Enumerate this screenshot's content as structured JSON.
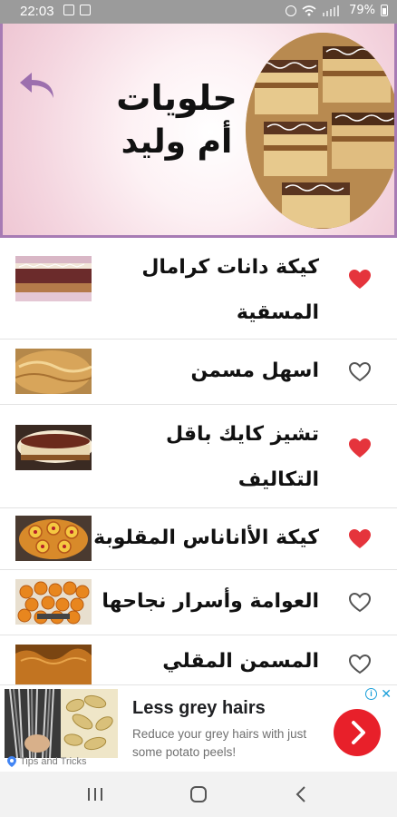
{
  "status_bar": {
    "time": "22:03",
    "battery_text": "79%",
    "icons": [
      "image-icon",
      "nfc-icon",
      "alarm-icon",
      "wifi-icon",
      "signal-icon",
      "battery-icon"
    ]
  },
  "banner": {
    "title_line1": "حلويات",
    "title_line2": "أم وليد",
    "back_icon": "back-arrow-icon",
    "accent_color": "#a77bb4"
  },
  "recipes": [
    {
      "title": "كيكة دانات كرامال المسقية",
      "favorite": true,
      "thumb": "caramel-cake"
    },
    {
      "title": "اسهل مسمن",
      "favorite": false,
      "thumb": "msemen"
    },
    {
      "title": "تشيز كايك باقل التكاليف",
      "favorite": true,
      "thumb": "cheesecake"
    },
    {
      "title": "كيكة الأاناناس المقلوبة",
      "favorite": true,
      "thumb": "pineapple-cake"
    },
    {
      "title": "العوامة وأسرار نجاحها",
      "favorite": false,
      "thumb": "awama"
    },
    {
      "title": "المسمن المقلي التقليدي",
      "favorite": false,
      "thumb": "fried-msemen"
    }
  ],
  "colors": {
    "heart_filled": "#e5343c",
    "heart_outline": "#555555"
  },
  "ad": {
    "title": "Less grey hairs",
    "body": "Reduce your grey hairs with just some potato peels!",
    "source": "Tips and Tricks",
    "cta_icon": "chevron-right-icon",
    "cta_color": "#e8202a"
  },
  "nav_bar": {
    "buttons": [
      "recent-apps-icon",
      "home-icon",
      "back-icon"
    ]
  }
}
